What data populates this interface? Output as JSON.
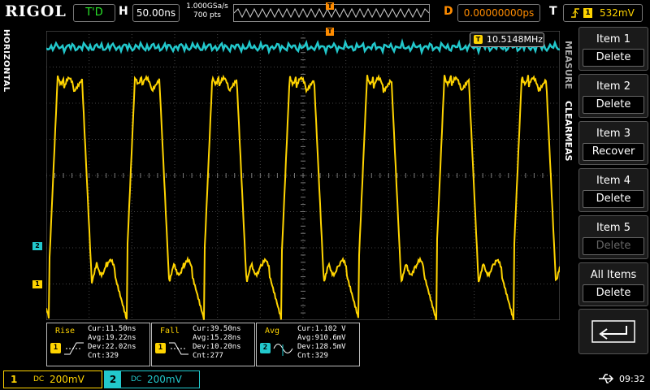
{
  "topbar": {
    "logo": "RIGOL",
    "run_state": "T'D",
    "h_label": "H",
    "timebase": "50.00ns",
    "sample_rate": "1.000GSa/s",
    "memory_depth": "700  pts",
    "trig_marker": "T",
    "d_label": "D",
    "delay": "0.00000000ps",
    "t_label": "T",
    "trigger_source": "1",
    "trigger_level": "532mV"
  },
  "side": {
    "horizontal_tab": "HORIZONTAL"
  },
  "screen": {
    "freq_badge": "T",
    "frequency": "10.5148MHz",
    "ch2_marker": "2",
    "ch1_marker": "1"
  },
  "measurements": [
    {
      "title": "Rise",
      "badge": "1",
      "cur": "Cur:11.50ns",
      "avg": "Avg:19.22ns",
      "dev": "Dev:22.02ns",
      "cnt": "Cnt:329"
    },
    {
      "title": "Fall",
      "badge": "1",
      "cur": "Cur:39.50ns",
      "avg": "Avg:15.28ns",
      "dev": "Dev:10.20ns",
      "cnt": "Cnt:277"
    },
    {
      "title": "Avg",
      "badge": "2",
      "cur": "Cur:1.102 V",
      "avg": "Avg:910.6mV",
      "dev": "Dev:128.5mV",
      "cnt": "Cnt:329"
    }
  ],
  "menu": {
    "measure_tab": "MEASURE",
    "clearmeas_tab": "CLEARMEAS",
    "items": [
      {
        "label": "Item 1",
        "button": "Delete"
      },
      {
        "label": "Item 2",
        "button": "Delete"
      },
      {
        "label": "Item 3",
        "button": "Recover"
      },
      {
        "label": "Item 4",
        "button": "Delete"
      },
      {
        "label": "Item 5",
        "button": "Delete"
      },
      {
        "label": "All Items",
        "button": "Delete"
      }
    ]
  },
  "bottombar": {
    "ch1_number": "1",
    "ch1_coupling": "DC",
    "ch1_scale": "200mV",
    "ch2_number": "2",
    "ch2_coupling": "DC",
    "ch2_scale": "200mV",
    "usb_icon": "usb-icon",
    "time": "09:32"
  },
  "colors": {
    "ch1": "#ffd400",
    "ch2": "#22c8cc",
    "trigger": "#ff8c00",
    "grid": "#555555"
  }
}
